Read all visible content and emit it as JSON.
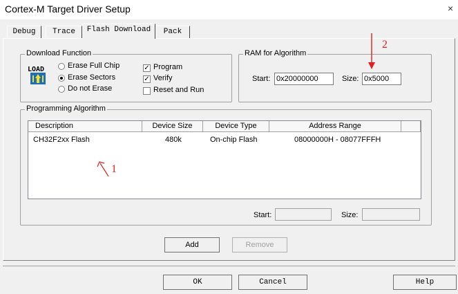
{
  "window": {
    "title": "Cortex-M Target Driver Setup",
    "close_glyph": "×"
  },
  "tabs": [
    {
      "label": "Debug"
    },
    {
      "label": "Trace"
    },
    {
      "label": "Flash Download"
    },
    {
      "label": "Pack"
    }
  ],
  "download_function": {
    "label": "Download Function",
    "load_icon_text": "LOAD",
    "options": [
      {
        "label": "Erase Full Chip",
        "selected": false
      },
      {
        "label": "Erase Sectors",
        "selected": true
      },
      {
        "label": "Do not Erase",
        "selected": false
      }
    ],
    "checks": [
      {
        "label": "Program",
        "checked": true
      },
      {
        "label": "Verify",
        "checked": true
      },
      {
        "label": "Reset and Run",
        "checked": false
      }
    ]
  },
  "ram": {
    "label": "RAM for Algorithm",
    "start_label": "Start:",
    "start_value": "0x20000000",
    "size_label": "Size:",
    "size_value": "0x5000"
  },
  "programming_algorithm": {
    "label": "Programming Algorithm",
    "columns": [
      "Description",
      "Device Size",
      "Device Type",
      "Address Range"
    ],
    "rows": [
      {
        "description": "CH32F2xx Flash",
        "size": "480k",
        "type": "On-chip Flash",
        "range": "08000000H - 08077FFFH"
      }
    ],
    "start_label": "Start:",
    "start_value": "",
    "size_label": "Size:",
    "size_value": ""
  },
  "buttons": {
    "add": "Add",
    "remove": "Remove",
    "ok": "OK",
    "cancel": "Cancel",
    "help": "Help"
  },
  "annotations": {
    "label1": "1",
    "label2": "2",
    "color": "#e02020"
  }
}
